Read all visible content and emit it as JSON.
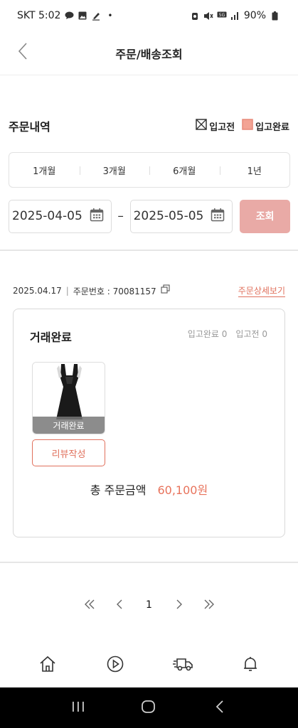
{
  "status_bar": {
    "carrier_time": "SKT 5:02",
    "dot": "•",
    "battery": "90%"
  },
  "header": {
    "title": "주문/배송조회"
  },
  "order_history": {
    "title": "주문내역",
    "legend": {
      "before_stock": "입고전",
      "stock_complete": "입고완료"
    }
  },
  "period_tabs": [
    "1개월",
    "3개월",
    "6개월",
    "1년"
  ],
  "date_range": {
    "start": "2025-04-05",
    "separator": "–",
    "end": "2025-05-05",
    "search_label": "조회"
  },
  "order": {
    "date": "2025.04.17",
    "divider": "|",
    "number_text": "주문번호 : 70081157",
    "detail_link": "주문상세보기",
    "status": "거래완료",
    "count_complete": "입고완료 0",
    "count_before": "입고전 0",
    "thumb_overlay": "거래완료",
    "review_button": "리뷰작성",
    "total_label": "총 주문금액",
    "total_value": "60,100원"
  },
  "pagination": {
    "current_page": "1"
  },
  "colors": {
    "accent": "#e8735c",
    "search_button": "#e9aaa6",
    "legend_fill": "#f3a394"
  },
  "icons": {
    "back": "chevron-left-icon",
    "calendar": "calendar-icon",
    "copy": "copy-icon",
    "nav": [
      "home-icon",
      "play-icon",
      "truck-icon",
      "bell-icon"
    ]
  }
}
